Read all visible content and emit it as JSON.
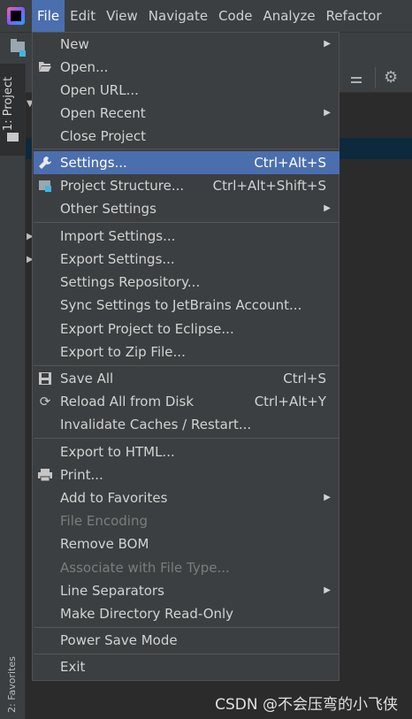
{
  "menubar": {
    "items": [
      "File",
      "Edit",
      "View",
      "Navigate",
      "Code",
      "Analyze",
      "Refactor"
    ]
  },
  "sidebar": {
    "project_tab": "1: Project",
    "favorites_tab": "2: Favorites"
  },
  "file_menu": {
    "items": [
      {
        "label": "New",
        "shortcut": "",
        "submenu": true,
        "icon": "",
        "enabled": true
      },
      {
        "label": "Open...",
        "shortcut": "",
        "submenu": false,
        "icon": "folder-open-icon",
        "enabled": true
      },
      {
        "label": "Open URL...",
        "shortcut": "",
        "submenu": false,
        "icon": "",
        "enabled": true
      },
      {
        "label": "Open Recent",
        "shortcut": "",
        "submenu": true,
        "icon": "",
        "enabled": true
      },
      {
        "label": "Close Project",
        "shortcut": "",
        "submenu": false,
        "icon": "",
        "enabled": true
      },
      {
        "label": "Settings...",
        "shortcut": "Ctrl+Alt+S",
        "submenu": false,
        "icon": "wrench-icon",
        "enabled": true,
        "selected": true
      },
      {
        "label": "Project Structure...",
        "shortcut": "Ctrl+Alt+Shift+S",
        "submenu": false,
        "icon": "project-structure-icon",
        "enabled": true
      },
      {
        "label": "Other Settings",
        "shortcut": "",
        "submenu": true,
        "icon": "",
        "enabled": true
      },
      {
        "label": "Import Settings...",
        "shortcut": "",
        "submenu": false,
        "icon": "",
        "enabled": true
      },
      {
        "label": "Export Settings...",
        "shortcut": "",
        "submenu": false,
        "icon": "",
        "enabled": true
      },
      {
        "label": "Settings Repository...",
        "shortcut": "",
        "submenu": false,
        "icon": "",
        "enabled": true
      },
      {
        "label": "Sync Settings to JetBrains Account...",
        "shortcut": "",
        "submenu": false,
        "icon": "",
        "enabled": true
      },
      {
        "label": "Export Project to Eclipse...",
        "shortcut": "",
        "submenu": false,
        "icon": "",
        "enabled": true
      },
      {
        "label": "Export to Zip File...",
        "shortcut": "",
        "submenu": false,
        "icon": "",
        "enabled": true
      },
      {
        "label": "Save All",
        "shortcut": "Ctrl+S",
        "submenu": false,
        "icon": "save-icon",
        "enabled": true
      },
      {
        "label": "Reload All from Disk",
        "shortcut": "Ctrl+Alt+Y",
        "submenu": false,
        "icon": "reload-icon",
        "enabled": true
      },
      {
        "label": "Invalidate Caches / Restart...",
        "shortcut": "",
        "submenu": false,
        "icon": "",
        "enabled": true
      },
      {
        "label": "Export to HTML...",
        "shortcut": "",
        "submenu": false,
        "icon": "",
        "enabled": true
      },
      {
        "label": "Print...",
        "shortcut": "",
        "submenu": false,
        "icon": "printer-icon",
        "enabled": true
      },
      {
        "label": "Add to Favorites",
        "shortcut": "",
        "submenu": true,
        "icon": "",
        "enabled": true
      },
      {
        "label": "File Encoding",
        "shortcut": "",
        "submenu": false,
        "icon": "",
        "enabled": false
      },
      {
        "label": "Remove BOM",
        "shortcut": "",
        "submenu": false,
        "icon": "",
        "enabled": true
      },
      {
        "label": "Associate with File Type...",
        "shortcut": "",
        "submenu": false,
        "icon": "",
        "enabled": false
      },
      {
        "label": "Line Separators",
        "shortcut": "",
        "submenu": true,
        "icon": "",
        "enabled": true
      },
      {
        "label": "Make Directory Read-Only",
        "shortcut": "",
        "submenu": false,
        "icon": "",
        "enabled": true
      },
      {
        "label": "Power Save Mode",
        "shortcut": "",
        "submenu": false,
        "icon": "",
        "enabled": true
      },
      {
        "label": "Exit",
        "shortcut": "",
        "submenu": false,
        "icon": "",
        "enabled": true
      }
    ]
  },
  "watermark": "CSDN @不会压弯的小飞侠"
}
